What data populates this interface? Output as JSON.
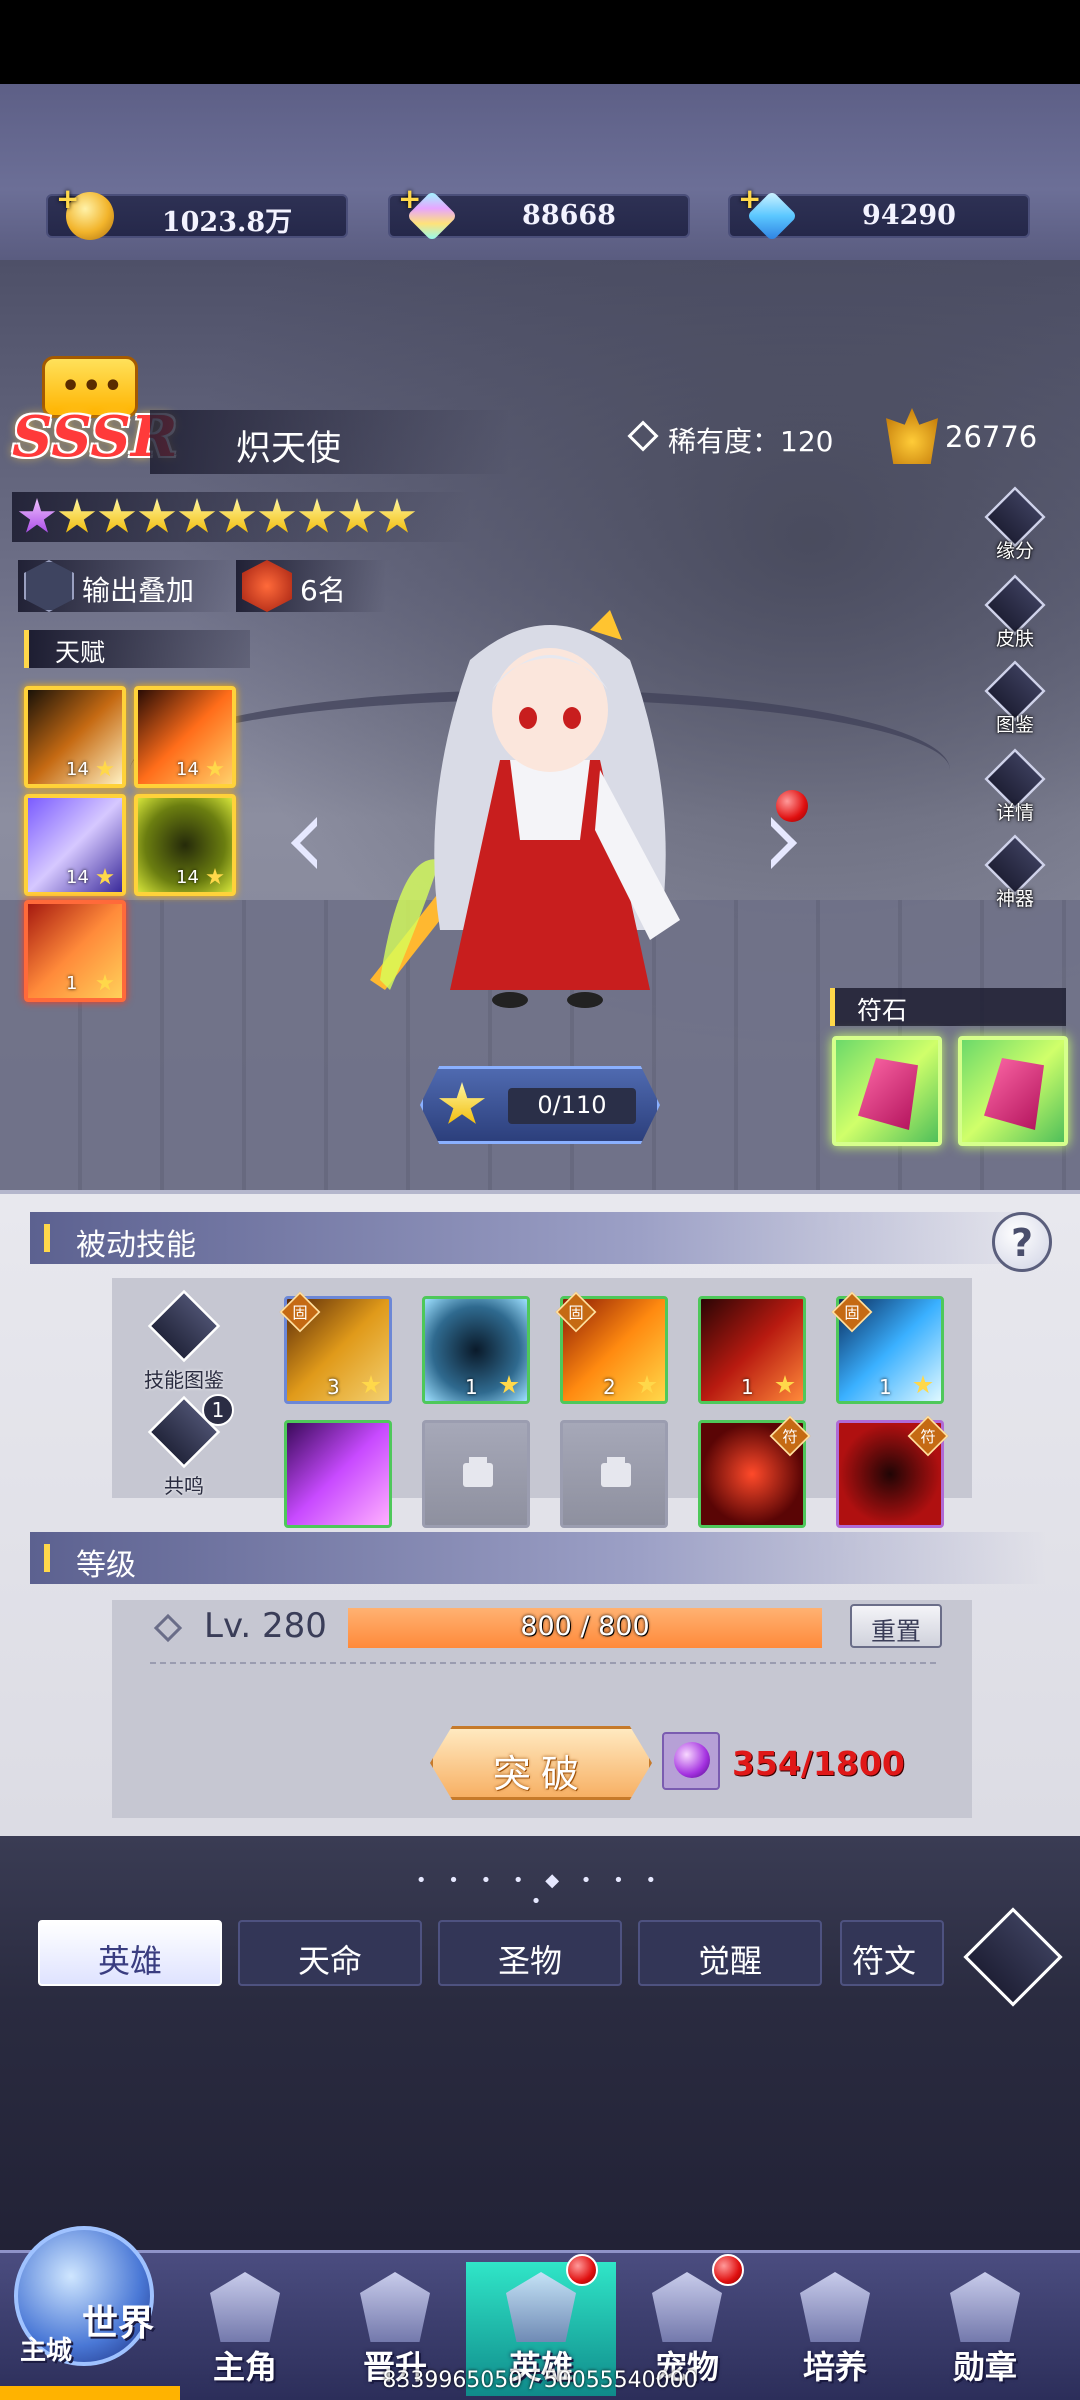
{
  "resources": {
    "gold": "1023.8万",
    "crystal": "88668",
    "diamond": "94290"
  },
  "hero": {
    "rarity": "SSSR",
    "bubble": "•••",
    "name": "炽天使",
    "rarity_label": "稀有度：120",
    "power": "26776",
    "stars_gold": 10,
    "stars_purple": 1,
    "tag_output": "输出叠加",
    "tag_rank": "6名"
  },
  "talent": {
    "title": "天赋",
    "items": [
      {
        "level": "14",
        "icon": "blade-icon"
      },
      {
        "level": "14",
        "icon": "flame-slash-icon"
      },
      {
        "level": "14",
        "icon": "wind-swirl-icon"
      },
      {
        "level": "14",
        "icon": "shadow-figure-icon"
      },
      {
        "level": "1",
        "icon": "flame-sword-icon"
      }
    ]
  },
  "side_buttons": {
    "fate": "缘分",
    "skin": "皮肤",
    "atlas": "图鉴",
    "detail": "详情",
    "artifact": "神器"
  },
  "runes": {
    "title": "符石"
  },
  "exp": {
    "text": "0/110"
  },
  "passive": {
    "title": "被动技能",
    "help": "?",
    "skill_atlas": "技能图鉴",
    "resonance": "共鸣",
    "resonance_badge": "1",
    "badge_fixed": "固",
    "badge_exclusive": "符",
    "skills": [
      {
        "level": "3"
      },
      {
        "level": "1"
      },
      {
        "level": "2"
      },
      {
        "level": "1"
      },
      {
        "level": "1"
      }
    ]
  },
  "level": {
    "title": "等级",
    "current": "Lv. 280",
    "bar_text": "800 / 800",
    "bar_fraction": 1.0,
    "reset": "重置",
    "breakthrough": "突破",
    "material": "354/1800"
  },
  "divider": "• • • • ◆ • • • •",
  "tabs": [
    "英雄",
    "天命",
    "圣物",
    "觉醒",
    "符文"
  ],
  "nav": {
    "world": "世界",
    "city": "主城",
    "main": "主角",
    "promote": "晋升",
    "hero": "英雄",
    "pet": "宠物",
    "train": "培养",
    "medal": "勋章"
  },
  "footer": "8339965050 / 50055540000",
  "colors": {
    "accent_gold": "#ffd84a",
    "panel": "#dcdce4",
    "nav_active": "#30e6c8",
    "material_red": "#e01818"
  }
}
